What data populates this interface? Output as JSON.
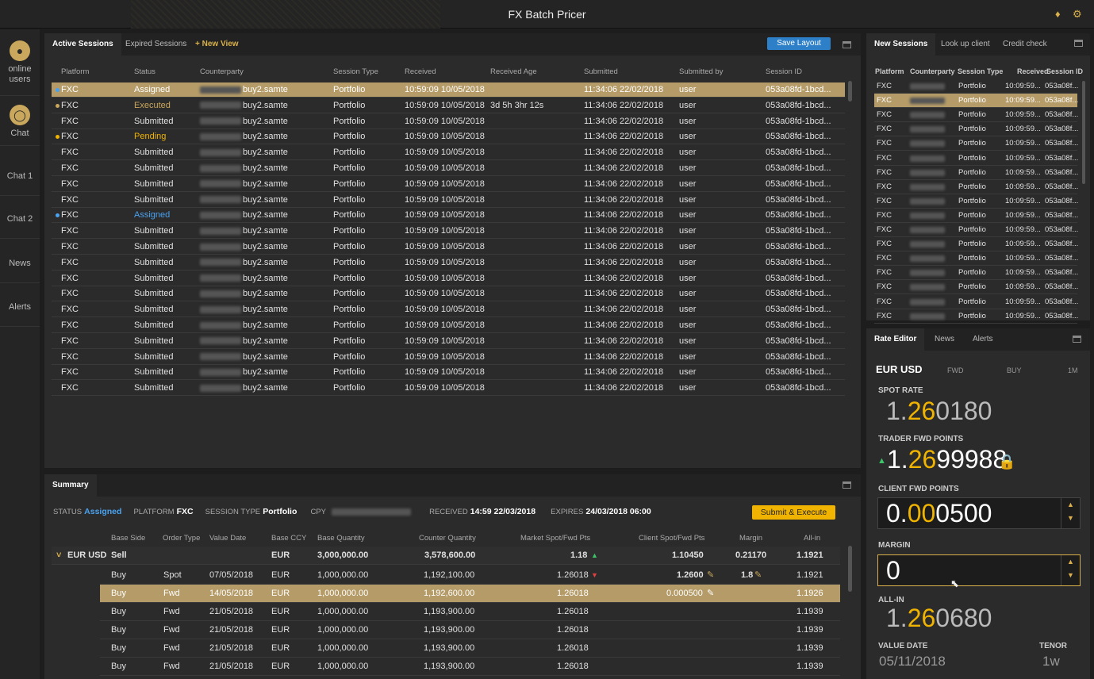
{
  "app": {
    "title": "FX Batch Pricer"
  },
  "sidebar": {
    "items": [
      {
        "label": "online users"
      },
      {
        "label": "Chat"
      },
      {
        "label": "Chat 1"
      },
      {
        "label": "Chat 2"
      },
      {
        "label": "News"
      },
      {
        "label": "Alerts"
      }
    ]
  },
  "sessions": {
    "tabs": [
      "Active Sessions",
      "Expired Sessions",
      "+ New View"
    ],
    "save_layout": "Save Layout",
    "columns": [
      "Platform",
      "Status",
      "Counterparty",
      "Session Type",
      "Received",
      "Received Age",
      "Submitted",
      "Submitted by",
      "Session ID"
    ],
    "rows": [
      {
        "platform": "FXC",
        "status": "Assigned",
        "cpty": "buy2.samte",
        "type": "Portfolio",
        "received": "10:59:09 10/05/2018",
        "age": "",
        "submitted": "11:34:06 22/02/2018",
        "by": "user",
        "id": "053a08fd-1bcd..."
      },
      {
        "platform": "FXC",
        "status": "Executed",
        "cpty": "buy2.samte",
        "type": "Portfolio",
        "received": "10:59:09 10/05/2018",
        "age": "3d 5h 3hr 12s",
        "submitted": "11:34:06 22/02/2018",
        "by": "user",
        "id": "053a08fd-1bcd..."
      },
      {
        "platform": "FXC",
        "status": "Submitted",
        "cpty": "buy2.samte",
        "type": "Portfolio",
        "received": "10:59:09 10/05/2018",
        "age": "",
        "submitted": "11:34:06 22/02/2018",
        "by": "user",
        "id": "053a08fd-1bcd..."
      },
      {
        "platform": "FXC",
        "status": "Pending",
        "cpty": "buy2.samte",
        "type": "Portfolio",
        "received": "10:59:09 10/05/2018",
        "age": "",
        "submitted": "11:34:06 22/02/2018",
        "by": "user",
        "id": "053a08fd-1bcd..."
      },
      {
        "platform": "FXC",
        "status": "Submitted",
        "cpty": "buy2.samte",
        "type": "Portfolio",
        "received": "10:59:09 10/05/2018",
        "age": "",
        "submitted": "11:34:06 22/02/2018",
        "by": "user",
        "id": "053a08fd-1bcd..."
      },
      {
        "platform": "FXC",
        "status": "Submitted",
        "cpty": "buy2.samte",
        "type": "Portfolio",
        "received": "10:59:09 10/05/2018",
        "age": "",
        "submitted": "11:34:06 22/02/2018",
        "by": "user",
        "id": "053a08fd-1bcd..."
      },
      {
        "platform": "FXC",
        "status": "Submitted",
        "cpty": "buy2.samte",
        "type": "Portfolio",
        "received": "10:59:09 10/05/2018",
        "age": "",
        "submitted": "11:34:06 22/02/2018",
        "by": "user",
        "id": "053a08fd-1bcd..."
      },
      {
        "platform": "FXC",
        "status": "Submitted",
        "cpty": "buy2.samte",
        "type": "Portfolio",
        "received": "10:59:09 10/05/2018",
        "age": "",
        "submitted": "11:34:06 22/02/2018",
        "by": "user",
        "id": "053a08fd-1bcd..."
      },
      {
        "platform": "FXC",
        "status": "Assigned",
        "cpty": "buy2.samte",
        "type": "Portfolio",
        "received": "10:59:09 10/05/2018",
        "age": "",
        "submitted": "11:34:06 22/02/2018",
        "by": "user",
        "id": "053a08fd-1bcd..."
      },
      {
        "platform": "FXC",
        "status": "Submitted",
        "cpty": "buy2.samte",
        "type": "Portfolio",
        "received": "10:59:09 10/05/2018",
        "age": "",
        "submitted": "11:34:06 22/02/2018",
        "by": "user",
        "id": "053a08fd-1bcd..."
      },
      {
        "platform": "FXC",
        "status": "Submitted",
        "cpty": "buy2.samte",
        "type": "Portfolio",
        "received": "10:59:09 10/05/2018",
        "age": "",
        "submitted": "11:34:06 22/02/2018",
        "by": "user",
        "id": "053a08fd-1bcd..."
      },
      {
        "platform": "FXC",
        "status": "Submitted",
        "cpty": "buy2.samte",
        "type": "Portfolio",
        "received": "10:59:09 10/05/2018",
        "age": "",
        "submitted": "11:34:06 22/02/2018",
        "by": "user",
        "id": "053a08fd-1bcd..."
      },
      {
        "platform": "FXC",
        "status": "Submitted",
        "cpty": "buy2.samte",
        "type": "Portfolio",
        "received": "10:59:09 10/05/2018",
        "age": "",
        "submitted": "11:34:06 22/02/2018",
        "by": "user",
        "id": "053a08fd-1bcd..."
      },
      {
        "platform": "FXC",
        "status": "Submitted",
        "cpty": "buy2.samte",
        "type": "Portfolio",
        "received": "10:59:09 10/05/2018",
        "age": "",
        "submitted": "11:34:06 22/02/2018",
        "by": "user",
        "id": "053a08fd-1bcd..."
      },
      {
        "platform": "FXC",
        "status": "Submitted",
        "cpty": "buy2.samte",
        "type": "Portfolio",
        "received": "10:59:09 10/05/2018",
        "age": "",
        "submitted": "11:34:06 22/02/2018",
        "by": "user",
        "id": "053a08fd-1bcd..."
      },
      {
        "platform": "FXC",
        "status": "Submitted",
        "cpty": "buy2.samte",
        "type": "Portfolio",
        "received": "10:59:09 10/05/2018",
        "age": "",
        "submitted": "11:34:06 22/02/2018",
        "by": "user",
        "id": "053a08fd-1bcd..."
      },
      {
        "platform": "FXC",
        "status": "Submitted",
        "cpty": "buy2.samte",
        "type": "Portfolio",
        "received": "10:59:09 10/05/2018",
        "age": "",
        "submitted": "11:34:06 22/02/2018",
        "by": "user",
        "id": "053a08fd-1bcd..."
      },
      {
        "platform": "FXC",
        "status": "Submitted",
        "cpty": "buy2.samte",
        "type": "Portfolio",
        "received": "10:59:09 10/05/2018",
        "age": "",
        "submitted": "11:34:06 22/02/2018",
        "by": "user",
        "id": "053a08fd-1bcd..."
      },
      {
        "platform": "FXC",
        "status": "Submitted",
        "cpty": "buy2.samte",
        "type": "Portfolio",
        "received": "10:59:09 10/05/2018",
        "age": "",
        "submitted": "11:34:06 22/02/2018",
        "by": "user",
        "id": "053a08fd-1bcd..."
      },
      {
        "platform": "FXC",
        "status": "Submitted",
        "cpty": "buy2.samte",
        "type": "Portfolio",
        "received": "10:59:09 10/05/2018",
        "age": "",
        "submitted": "11:34:06 22/02/2018",
        "by": "user",
        "id": "053a08fd-1bcd..."
      }
    ]
  },
  "status_colors": {
    "Assigned": "#4aa3f0",
    "Executed": "#c9a75c",
    "Pending": "#f0b400",
    "Submitted": "#e0e0e0"
  },
  "new_sessions": {
    "tabs": [
      "New Sessions",
      "Look up client",
      "Credit check"
    ],
    "columns": [
      "Platform",
      "Counterparty",
      "Session Type",
      "Received",
      "Session ID"
    ],
    "rows": [
      {
        "platform": "FXC",
        "type": "Portfolio",
        "received": "10:09:59...",
        "id": "053a08f..."
      },
      {
        "platform": "FXC",
        "type": "Portfolio",
        "received": "10:09:59...",
        "id": "053a08f..."
      },
      {
        "platform": "FXC",
        "type": "Portfolio",
        "received": "10:09:59...",
        "id": "053a08f..."
      },
      {
        "platform": "FXC",
        "type": "Portfolio",
        "received": "10:09:59...",
        "id": "053a08f..."
      },
      {
        "platform": "FXC",
        "type": "Portfolio",
        "received": "10:09:59...",
        "id": "053a08f..."
      },
      {
        "platform": "FXC",
        "type": "Portfolio",
        "received": "10:09:59...",
        "id": "053a08f..."
      },
      {
        "platform": "FXC",
        "type": "Portfolio",
        "received": "10:09:59...",
        "id": "053a08f..."
      },
      {
        "platform": "FXC",
        "type": "Portfolio",
        "received": "10:09:59...",
        "id": "053a08f..."
      },
      {
        "platform": "FXC",
        "type": "Portfolio",
        "received": "10:09:59...",
        "id": "053a08f..."
      },
      {
        "platform": "FXC",
        "type": "Portfolio",
        "received": "10:09:59...",
        "id": "053a08f..."
      },
      {
        "platform": "FXC",
        "type": "Portfolio",
        "received": "10:09:59...",
        "id": "053a08f..."
      },
      {
        "platform": "FXC",
        "type": "Portfolio",
        "received": "10:09:59...",
        "id": "053a08f..."
      },
      {
        "platform": "FXC",
        "type": "Portfolio",
        "received": "10:09:59...",
        "id": "053a08f..."
      },
      {
        "platform": "FXC",
        "type": "Portfolio",
        "received": "10:09:59...",
        "id": "053a08f..."
      },
      {
        "platform": "FXC",
        "type": "Portfolio",
        "received": "10:09:59...",
        "id": "053a08f..."
      },
      {
        "platform": "FXC",
        "type": "Portfolio",
        "received": "10:09:59...",
        "id": "053a08f..."
      },
      {
        "platform": "FXC",
        "type": "Portfolio",
        "received": "10:09:59...",
        "id": "053a08f..."
      }
    ]
  },
  "summary": {
    "tab": "Summary",
    "status_label": "STATUS",
    "status": "Assigned",
    "platform_label": "PLATFORM",
    "platform": "FXC",
    "session_type_label": "SESSION TYPE",
    "session_type": "Portfolio",
    "cpy_label": "CPY",
    "received_label": "RECEIVED",
    "received": "14:59 22/03/2018",
    "expires_label": "EXPIRES",
    "expires": "24/03/2018 06:00",
    "submit_label": "Submit & Execute",
    "columns": [
      "Base Side",
      "Order Type",
      "Value Date",
      "Base CCY",
      "Base Quantity",
      "Counter Quantity",
      "Market Spot/Fwd Pts",
      "Client Spot/Fwd Pts",
      "Margin",
      "All-in"
    ],
    "group": {
      "pair": "EUR USD",
      "side": "Sell",
      "ccy": "EUR",
      "base_qty": "3,000,000.00",
      "counter_qty": "3,578,600.00",
      "market": "1.18",
      "client": "1.10450",
      "margin": "0.21170",
      "allin": "1.1921"
    },
    "legs": [
      {
        "side": "Buy",
        "type": "Spot",
        "date": "07/05/2018",
        "ccy": "EUR",
        "base_qty": "1,000,000.00",
        "counter_qty": "1,192,100.00",
        "market": "1.26018",
        "client": "1.2600",
        "margin": "1.8",
        "allin": "1.1921"
      },
      {
        "side": "Buy",
        "type": "Fwd",
        "date": "14/05/2018",
        "ccy": "EUR",
        "base_qty": "1,000,000.00",
        "counter_qty": "1,192,600.00",
        "market": "1.26018",
        "client": "0.000500",
        "margin": "",
        "allin": "1.1926"
      },
      {
        "side": "Buy",
        "type": "Fwd",
        "date": "21/05/2018",
        "ccy": "EUR",
        "base_qty": "1,000,000.00",
        "counter_qty": "1,193,900.00",
        "market": "1.26018",
        "client": "",
        "margin": "",
        "allin": "1.1939"
      },
      {
        "side": "Buy",
        "type": "Fwd",
        "date": "21/05/2018",
        "ccy": "EUR",
        "base_qty": "1,000,000.00",
        "counter_qty": "1,193,900.00",
        "market": "1.26018",
        "client": "",
        "margin": "",
        "allin": "1.1939"
      },
      {
        "side": "Buy",
        "type": "Fwd",
        "date": "21/05/2018",
        "ccy": "EUR",
        "base_qty": "1,000,000.00",
        "counter_qty": "1,193,900.00",
        "market": "1.26018",
        "client": "",
        "margin": "",
        "allin": "1.1939"
      },
      {
        "side": "Buy",
        "type": "Fwd",
        "date": "21/05/2018",
        "ccy": "EUR",
        "base_qty": "1,000,000.00",
        "counter_qty": "1,193,900.00",
        "market": "1.26018",
        "client": "",
        "margin": "",
        "allin": "1.1939"
      }
    ]
  },
  "rate_editor": {
    "tabs": [
      "Rate Editor",
      "News",
      "Alerts"
    ],
    "pair": "EUR USD",
    "fwd": "FWD",
    "side": "BUY",
    "tenor_short": "1M",
    "spot_label": "SPOT RATE",
    "spot_a": "1.",
    "spot_b": "26",
    "spot_c": "0180",
    "trader_label": "TRADER FWD POINTS",
    "trader_a": "1.",
    "trader_b": "26",
    "trader_c": "99988",
    "client_label": "CLIENT FWD POINTS",
    "client_a": "0.",
    "client_b": "00",
    "client_c": "0500",
    "margin_label": "MARGIN",
    "margin": "0",
    "allin_label": "ALL-IN",
    "allin_a": "1.",
    "allin_b": "26",
    "allin_c": "0680",
    "value_date_label": "VALUE DATE",
    "value_date": "05/11/2018",
    "tenor_label": "TENOR",
    "tenor": "1w"
  }
}
